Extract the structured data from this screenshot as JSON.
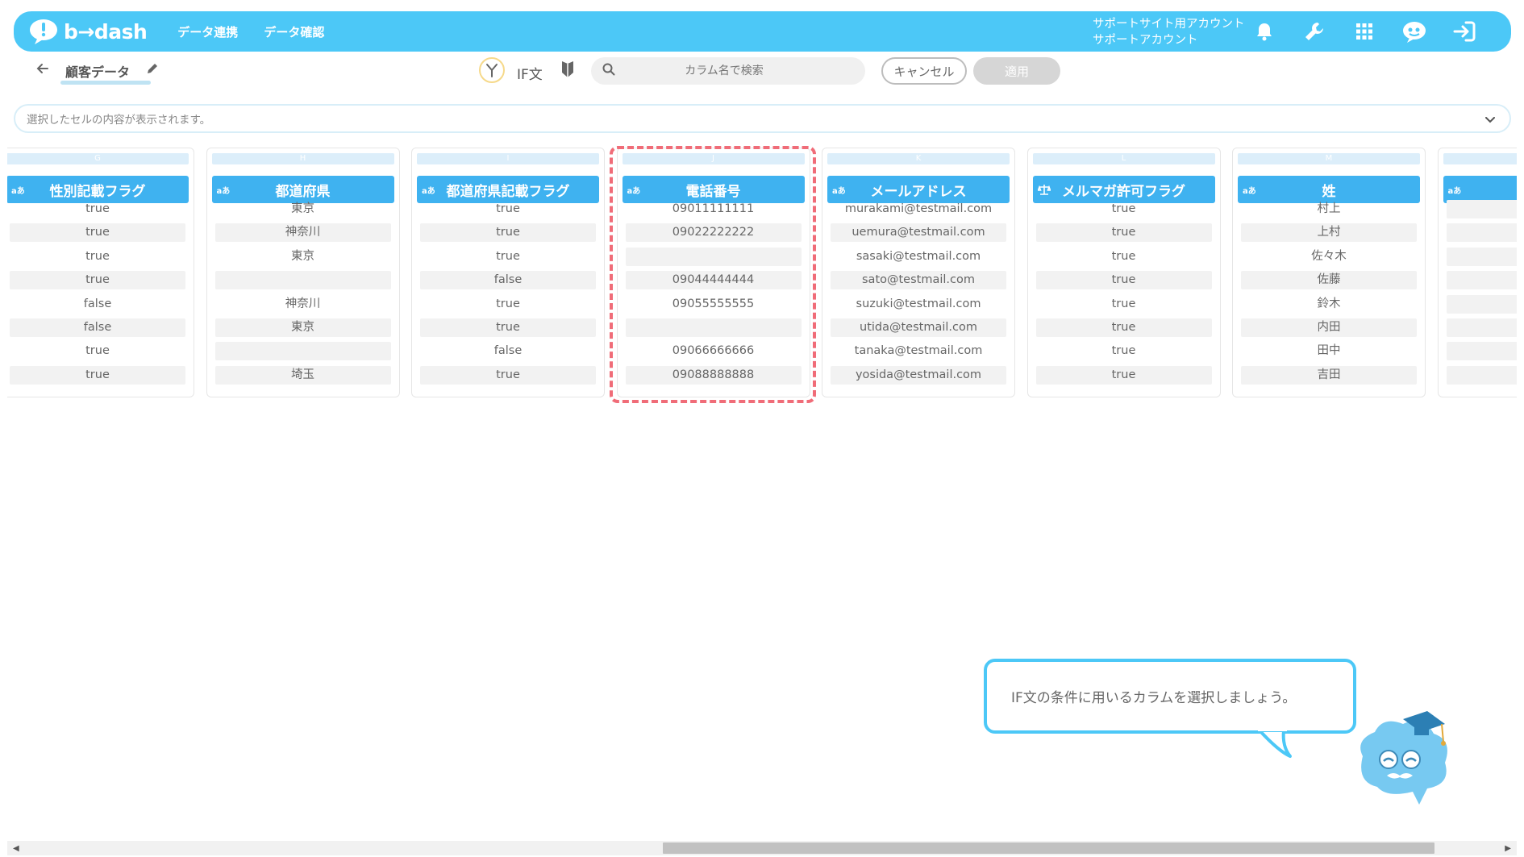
{
  "header": {
    "brand": "b→dash",
    "nav": [
      "データ連携",
      "データ確認"
    ],
    "account_line1": "サポートサイト用アカウント",
    "account_line2": "サポートアカウント",
    "accent": "#4cc8f7"
  },
  "toolbar": {
    "page_title": "顧客データ",
    "if_label": "IF文",
    "search_placeholder": "カラム名で検索",
    "cancel_label": "キャンセル",
    "apply_label": "適用"
  },
  "cellbar": {
    "placeholder": "選択したセルの内容が表示されます。"
  },
  "columns": [
    {
      "letter": "G",
      "badge": "aあ",
      "name": "性別記載フラグ",
      "cells": [
        "true",
        "true",
        "true",
        "true",
        "false",
        "false",
        "true",
        "true"
      ]
    },
    {
      "letter": "H",
      "badge": "aあ",
      "name": "都道府県",
      "cells": [
        "東京",
        "神奈川",
        "東京",
        "",
        "神奈川",
        "東京",
        "",
        "埼玉"
      ]
    },
    {
      "letter": "I",
      "badge": "aあ",
      "name": "都道府県記載フラグ",
      "cells": [
        "true",
        "true",
        "true",
        "false",
        "true",
        "true",
        "false",
        "true"
      ]
    },
    {
      "letter": "J",
      "badge": "aあ",
      "name": "電話番号",
      "cells": [
        "09011111111",
        "09022222222",
        "",
        "09044444444",
        "09055555555",
        "",
        "09066666666",
        "09088888888"
      ]
    },
    {
      "letter": "K",
      "badge": "aあ",
      "name": "メールアドレス",
      "cells": [
        "murakami@testmail.com",
        "uemura@testmail.com",
        "sasaki@testmail.com",
        "sato@testmail.com",
        "suzuki@testmail.com",
        "utida@testmail.com",
        "tanaka@testmail.com",
        "yosida@testmail.com"
      ]
    },
    {
      "letter": "L",
      "badge": "scale",
      "name": "メルマガ許可フラグ",
      "cells": [
        "true",
        "true",
        "true",
        "true",
        "true",
        "true",
        "true",
        "true"
      ]
    },
    {
      "letter": "M",
      "badge": "aあ",
      "name": "姓",
      "cells": [
        "村上",
        "上村",
        "佐々木",
        "佐藤",
        "鈴木",
        "内田",
        "田中",
        "吉田"
      ]
    },
    {
      "letter": "",
      "badge": "aあ",
      "name": "",
      "cells": [
        "",
        "",
        "",
        "",
        "",
        "",
        "",
        ""
      ]
    }
  ],
  "tutorial": {
    "message": "IF文の条件に用いるカラムを選択しましょう。"
  },
  "scrollbar": {
    "position_fraction": 0.43
  }
}
